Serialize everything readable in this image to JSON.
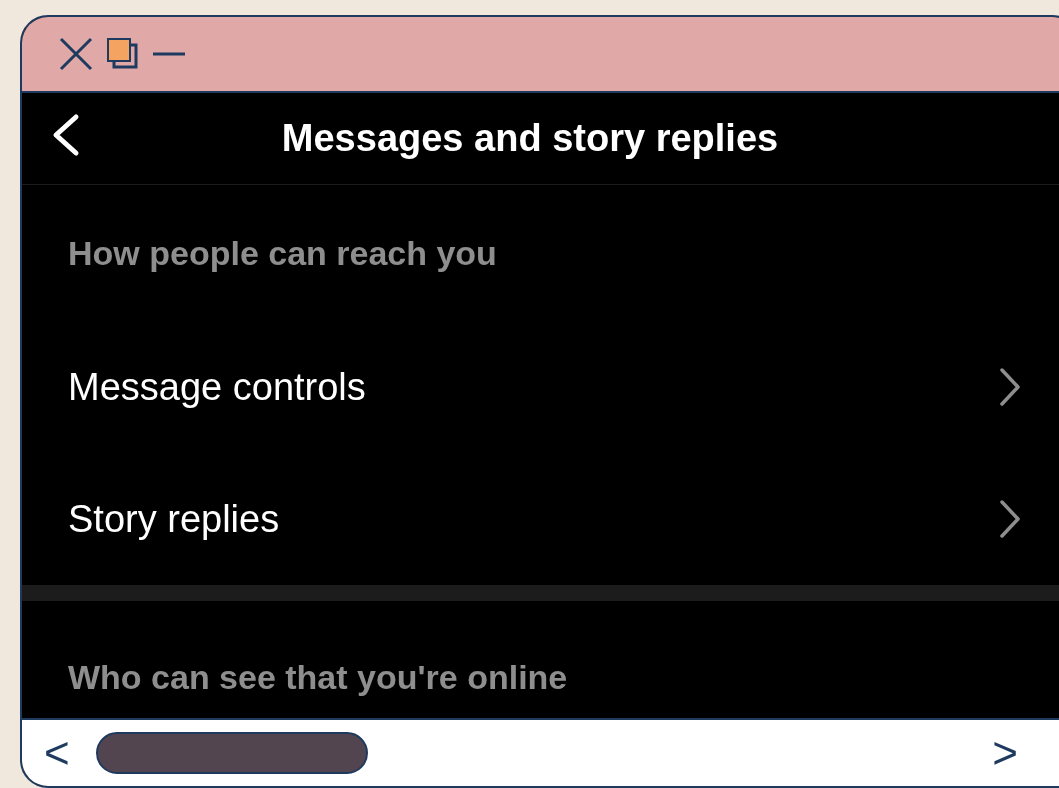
{
  "header": {
    "title": "Messages and story replies"
  },
  "sections": [
    {
      "heading": "How people can reach you",
      "items": [
        {
          "label": "Message controls"
        },
        {
          "label": "Story replies"
        }
      ]
    },
    {
      "heading": "Who can see that you're online"
    }
  ],
  "scrollbar": {
    "left_arrow": "<",
    "right_arrow": ">"
  }
}
